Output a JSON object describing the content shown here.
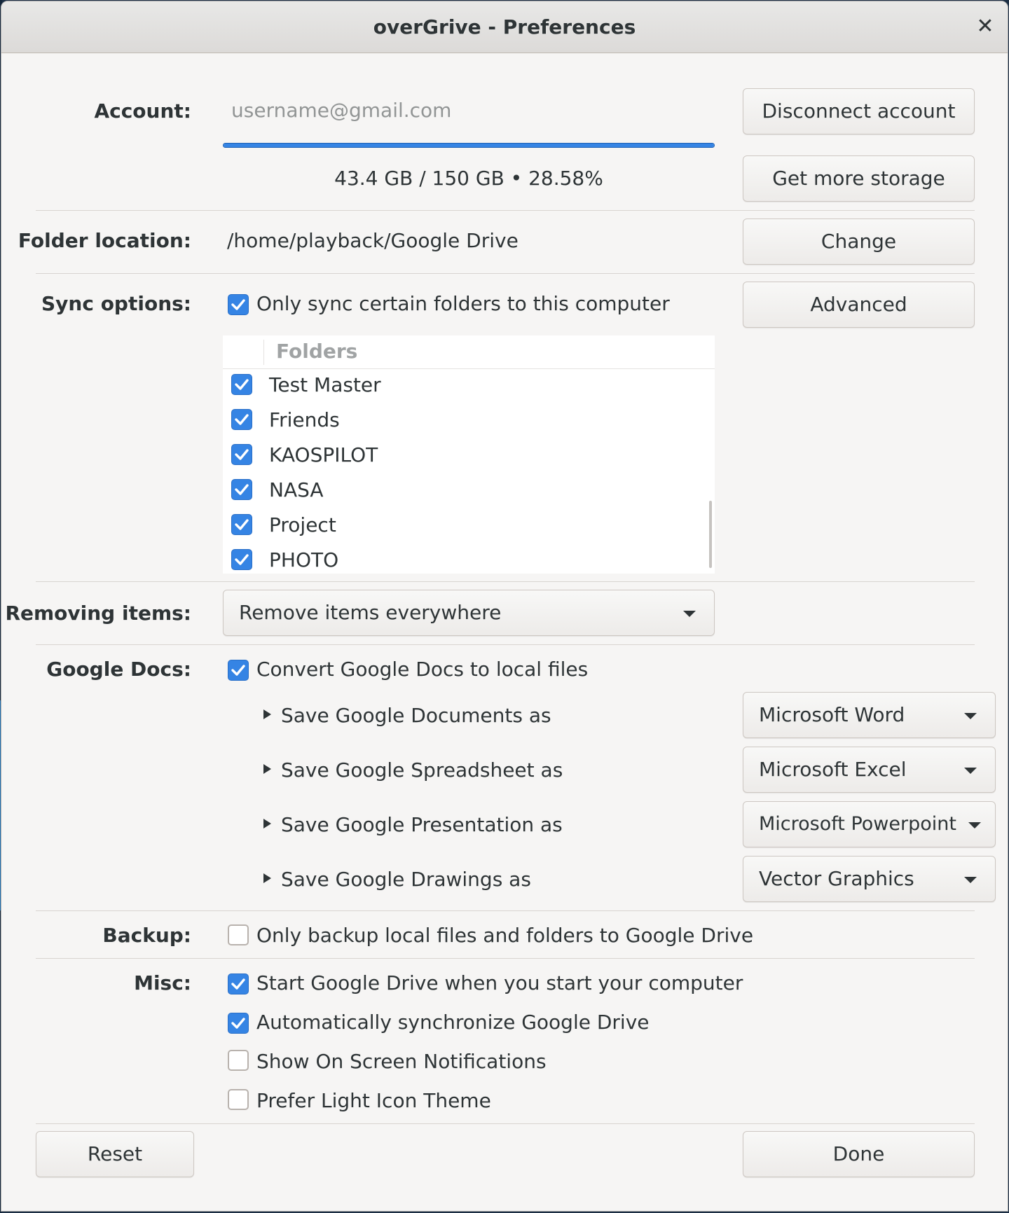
{
  "window": {
    "title": "overGrive - Preferences"
  },
  "account": {
    "label": "Account:",
    "placeholder": "username@gmail.com",
    "disconnect_label": "Disconnect account",
    "storage_text": "43.4 GB / 150 GB  •  28.58%",
    "storage_percent": 28.58,
    "get_storage_label": "Get more storage"
  },
  "folder_location": {
    "label": "Folder location:",
    "path": "/home/playback/Google Drive",
    "change_label": "Change"
  },
  "sync_options": {
    "label": "Sync options:",
    "only_certain_label": "Only sync certain folders to this computer",
    "only_certain_checked": true,
    "advanced_label": "Advanced",
    "folders_header": "Folders",
    "folders": [
      {
        "name": "Test Master",
        "checked": true
      },
      {
        "name": "Friends",
        "checked": true
      },
      {
        "name": "KAOSPILOT",
        "checked": true
      },
      {
        "name": "NASA",
        "checked": true
      },
      {
        "name": "Project",
        "checked": true
      },
      {
        "name": "PHOTO",
        "checked": true
      }
    ]
  },
  "removing_items": {
    "label": "Removing items:",
    "selected": "Remove items everywhere"
  },
  "google_docs": {
    "label": "Google Docs:",
    "convert_label": "Convert Google Docs to local files",
    "convert_checked": true,
    "rows": [
      {
        "label": "Save Google Documents as",
        "value": "Microsoft Word"
      },
      {
        "label": "Save Google Spreadsheet as",
        "value": "Microsoft Excel"
      },
      {
        "label": "Save Google Presentation as",
        "value": "Microsoft Powerpoint"
      },
      {
        "label": "Save Google Drawings as",
        "value": "Vector Graphics"
      }
    ]
  },
  "backup": {
    "label": "Backup:",
    "only_backup_label": "Only backup local files and folders to Google Drive",
    "only_backup_checked": false
  },
  "misc": {
    "label": "Misc:",
    "items": [
      {
        "label": "Start Google Drive when you start your computer",
        "checked": true
      },
      {
        "label": "Automatically synchronize Google Drive",
        "checked": true
      },
      {
        "label": "Show On Screen Notifications",
        "checked": false
      },
      {
        "label": "Prefer Light Icon Theme",
        "checked": false
      }
    ]
  },
  "footer": {
    "reset_label": "Reset",
    "done_label": "Done"
  },
  "colors": {
    "accent": "#3584e4",
    "background": "#f6f5f4"
  }
}
